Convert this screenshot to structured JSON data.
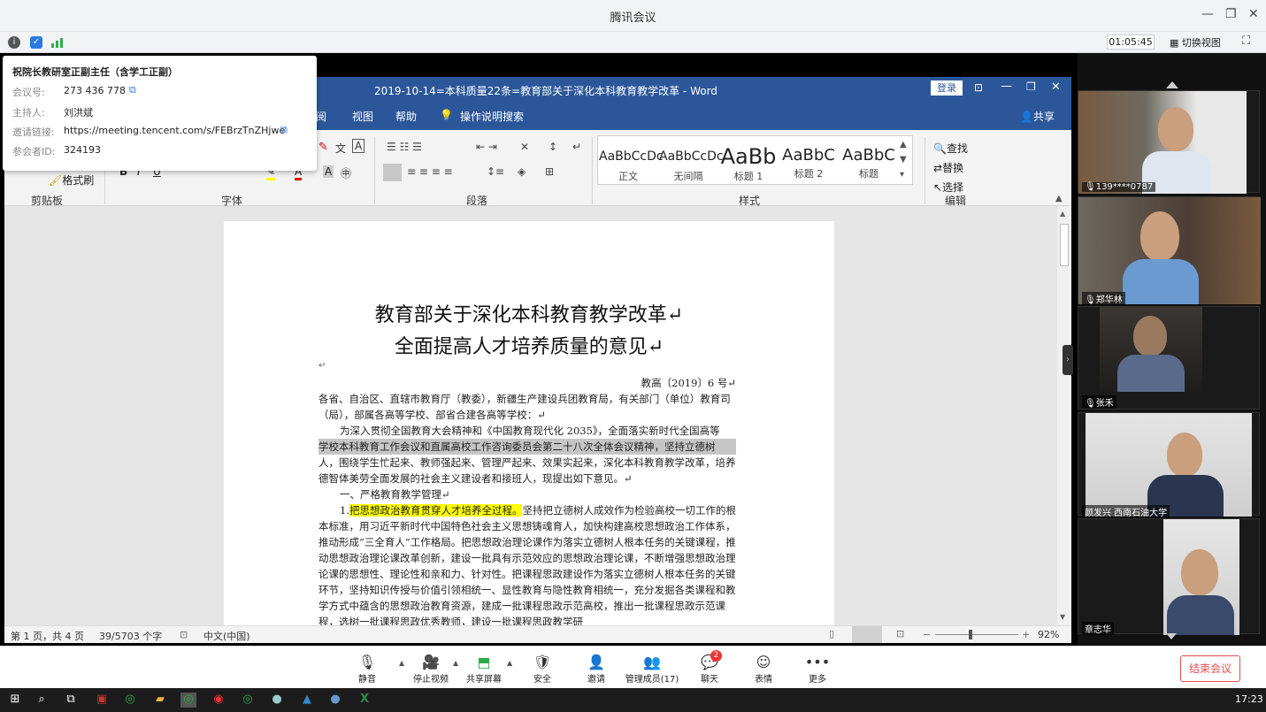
{
  "window": {
    "title": "腾讯会议"
  },
  "infobar": {
    "timer": "01:05:45",
    "switch_view": "切换视图"
  },
  "popup": {
    "meeting_title": "祝院长教研室正副主任（含学工正副）",
    "meeting_id_label": "会议号:",
    "meeting_id": "273 436 778",
    "host_label": "主持人:",
    "host": "刘洪斌",
    "invite_label": "邀请链接:",
    "invite_link": "https://meeting.tencent.com/s/FEBrzTnZHjwe",
    "participant_label": "参会者ID:",
    "participant_id": "324193"
  },
  "word": {
    "title": "2019-10-14=本科质量22条=教育部关于深化本科教育教学改革 - Word",
    "login": "登录",
    "tabs": [
      "阅",
      "视图",
      "帮助",
      "操作说明搜索"
    ],
    "share": "共享",
    "clipboard": {
      "format_painter": "格式刷",
      "group": "剪贴板"
    },
    "font_group": "字体",
    "paragraph_group": "段落",
    "styles_group": "样式",
    "editing_group": "编辑",
    "styles": [
      {
        "preview": "AaBbCcDc",
        "name": "正文"
      },
      {
        "preview": "AaBbCcDc",
        "name": "无间隔"
      },
      {
        "preview": "AaBb",
        "name": "标题 1"
      },
      {
        "preview": "AaBbC",
        "name": "标题 2"
      },
      {
        "preview": "AaBbC",
        "name": "标题"
      }
    ],
    "editing": {
      "find": "查找",
      "replace": "替换",
      "select": "选择"
    },
    "doc": {
      "heading1": "教育部关于深化本科教育教学改革↵",
      "heading2": "全面提高人才培养质量的意见↵",
      "return_mark": "↵",
      "doc_number": "教高〔2019〕6 号↵",
      "p1": "各省、自治区、直辖市教育厅（教委），新疆生产建设兵团教育局，有关部门（单位）教育司（局），部属各高等学校、部省合建各高等学校：↵",
      "p2a": "为深入贯彻全国教育大会精神和《中国教育现代化 2035》，全面落实新时代全国高等",
      "p2b": "学校本科教育工作会议和直属高校工作咨询委员会第二十八次全体会议精神，坚持立德树",
      "p2c": "人，围绕学生忙起来、教师强起来、管理严起来、效果实起来，深化本科教育教学改革，培养德智体美劳全面发展的社会主义建设者和接班人，现提出如下意见。↵",
      "section1": "一、严格教育教学管理↵",
      "p3_num": "1.",
      "p3_hl": "把思想政治教育贯穿人才培养全过程。",
      "p3_rest": "坚持把立德树人成效作为检验高校一切工作的根本标准，用习近平新时代中国特色社会主义思想铸魂育人，加快构建高校思想政治工作体系，推动形成“三全育人”工作格局。把思想政治理论课作为落实立德树人根本任务的关键课程，推动思想政治理论课改革创新，建设一批具有示范效应的思想政治理论课，不断增强思想政治理论课的思想性、理论性和亲和力、针对性。把课程思政建设作为落实立德树人根本任务的关键环节，坚持知识传授与价值引领相统一、显性教育与隐性教育相统一，充分发掘各类课程和教学方式中蕴含的思想政治教育资源，建成一批课程思政示范高校，推出一批课程思政示范课程，选树一批课程思政优秀教师，建设一批课程思政教学研"
    },
    "status": {
      "page": "第 1 页，共 4 页",
      "words": "39/5703 个字",
      "lang": "中文(中国)",
      "zoom": "92%"
    }
  },
  "videos": [
    {
      "name": "139****0787"
    },
    {
      "name": "郑华林"
    },
    {
      "name": "张禾"
    },
    {
      "name": "颜发兴 西南石油大学"
    },
    {
      "name": "章志华"
    }
  ],
  "toolbar": {
    "mute": "静音",
    "stop_video": "停止视频",
    "share_screen": "共享屏幕",
    "security": "安全",
    "invite": "邀请",
    "members": "管理成员(17)",
    "chat": "聊天",
    "chat_badge": "2",
    "reactions": "表情",
    "more": "更多",
    "end": "结束会议"
  },
  "taskbar": {
    "time": "17:23"
  }
}
